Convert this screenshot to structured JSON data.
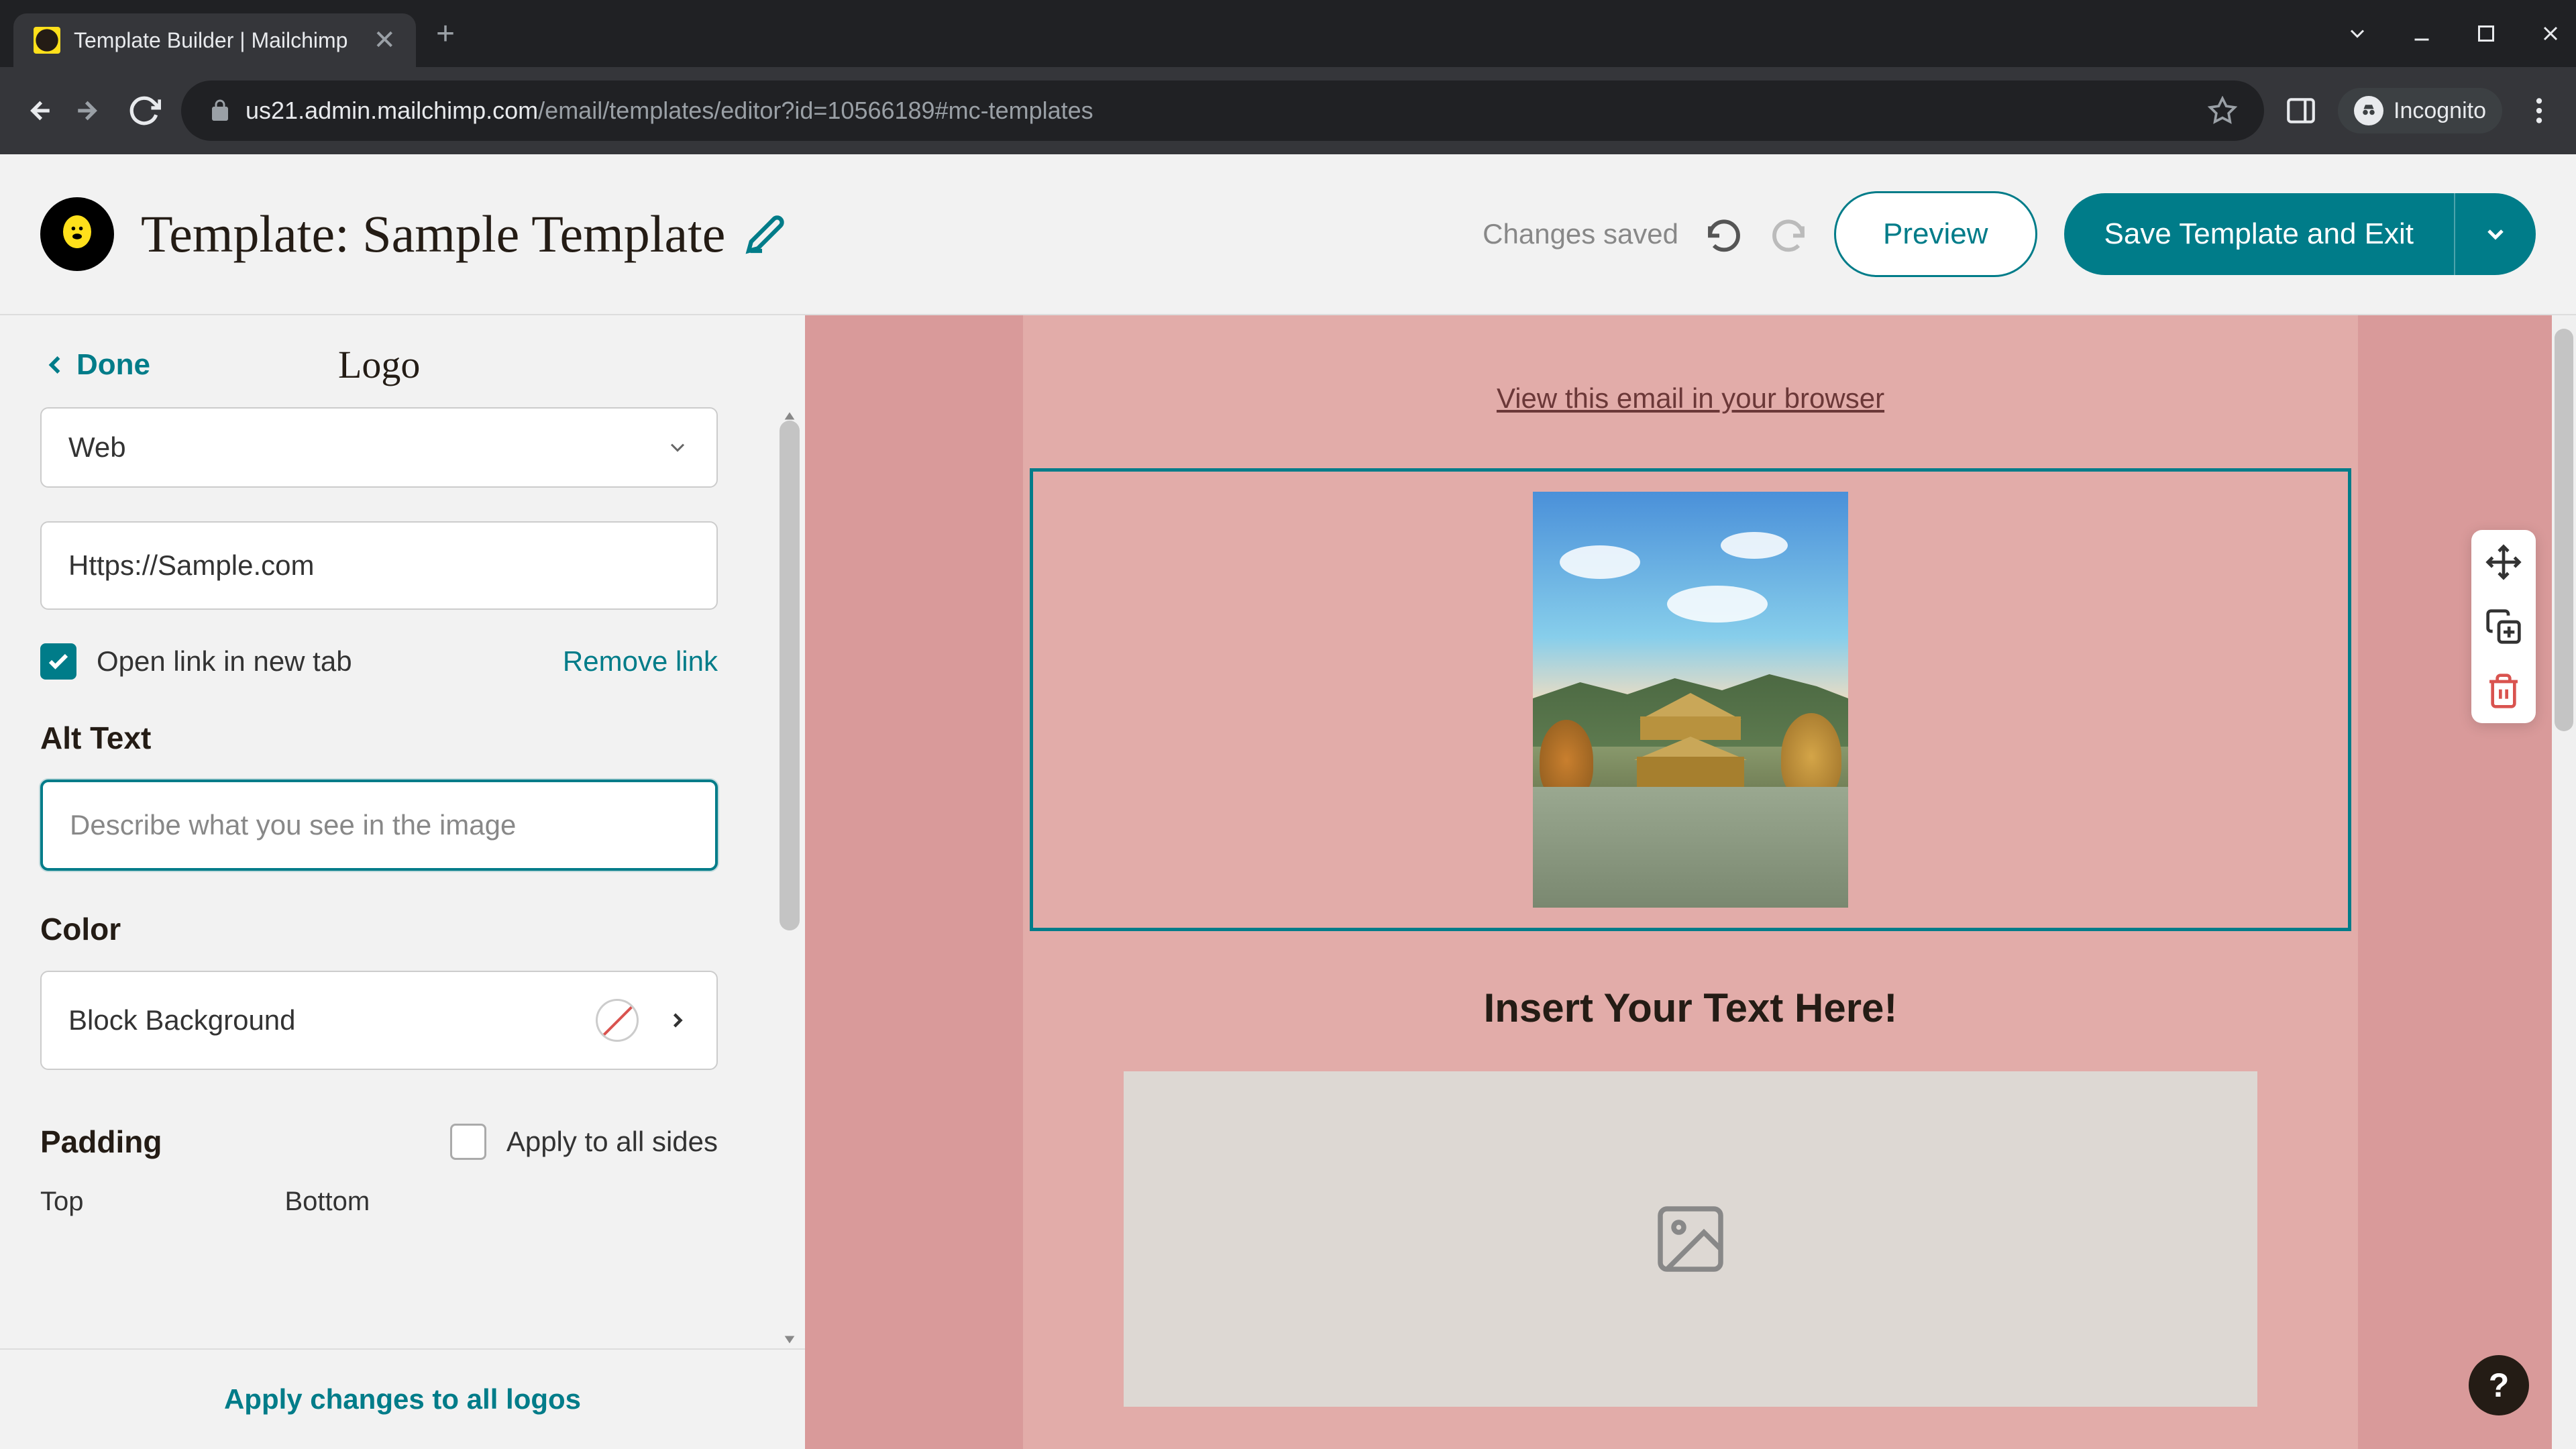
{
  "browser": {
    "tab_title": "Template Builder | Mailchimp",
    "url_host": "us21.admin.mailchimp.com",
    "url_path": "/email/templates/editor?id=10566189#mc-templates",
    "incognito_label": "Incognito"
  },
  "header": {
    "title": "Template: Sample Template",
    "status": "Changes saved",
    "preview_label": "Preview",
    "save_label": "Save Template and Exit"
  },
  "sidebar": {
    "done_label": "Done",
    "panel_title": "Logo",
    "link_type_value": "Web",
    "url_value": "Https://Sample.com",
    "open_new_tab_label": "Open link in new tab",
    "remove_link_label": "Remove link",
    "alt_text_label": "Alt Text",
    "alt_text_placeholder": "Describe what you see in the image",
    "alt_text_value": "",
    "color_label": "Color",
    "block_bg_label": "Block Background",
    "padding_label": "Padding",
    "apply_all_sides_label": "Apply to all sides",
    "padding_top_label": "Top",
    "padding_bottom_label": "Bottom",
    "apply_all_logos_label": "Apply changes to all logos"
  },
  "canvas": {
    "view_browser_text": "View this email in your browser",
    "text_block": "Insert Your Text Here!"
  }
}
